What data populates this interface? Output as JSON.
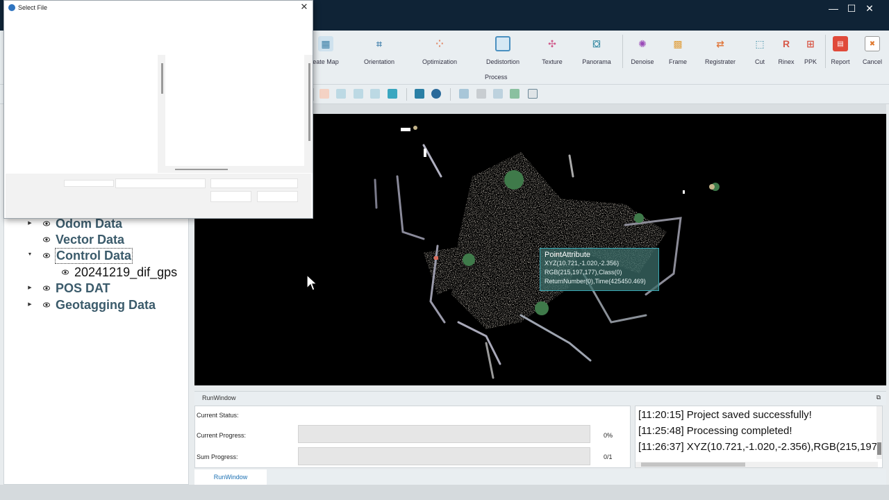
{
  "window": {
    "minimize": "—",
    "maximize": "☐",
    "close": "✕"
  },
  "ribbon": {
    "buttons": [
      {
        "label": "eate Map",
        "icon": "create-map-icon"
      },
      {
        "label": "Orientation",
        "icon": "orientation-icon"
      },
      {
        "label": "Optimization",
        "icon": "optimization-icon"
      },
      {
        "label": "Dedistortion",
        "icon": "dedistortion-icon"
      },
      {
        "label": "Texture",
        "icon": "texture-icon"
      },
      {
        "label": "Panorama",
        "icon": "panorama-icon"
      },
      {
        "label": "Denoise",
        "icon": "denoise-icon"
      },
      {
        "label": "Frame",
        "icon": "frame-icon"
      },
      {
        "label": "Registrater",
        "icon": "register-icon"
      },
      {
        "label": "Cut",
        "icon": "cut-icon"
      },
      {
        "label": "Rinex",
        "icon": "rinex-icon"
      },
      {
        "label": "PPK",
        "icon": "ppk-icon"
      },
      {
        "label": "Report",
        "icon": "report-icon"
      },
      {
        "label": "Cancel",
        "icon": "cancel-icon"
      }
    ],
    "group_label": "Process"
  },
  "tree": {
    "items": [
      {
        "label": "Odom Data"
      },
      {
        "label": "Vector Data"
      },
      {
        "label": "Control Data"
      },
      {
        "label": "20241219_dif_gps"
      },
      {
        "label": "POS DAT"
      },
      {
        "label": "Geotagging Data"
      }
    ]
  },
  "tooltip": {
    "title": "PointAttribute",
    "xyz": "XYZ(10.721,-1.020,-2.356)",
    "rgb": "RGB(215,197,177),Class(0)",
    "ret": "ReturnNumber(0),Time(425450.469)"
  },
  "run": {
    "title": "RunWindow",
    "float_icon": "⧉",
    "status_label": "Current Status:",
    "status_value": "",
    "progress_label": "Current Progress:",
    "progress_value": "0%",
    "progress_fraction": 0,
    "sum_label": "Sum Progress:",
    "sum_value": "0/1",
    "sum_fraction": 0,
    "tab": "RunWindow"
  },
  "log": [
    "[11:20:15] Project saved successfully!",
    "[11:25:48] Processing completed!",
    "[11:26:37] XYZ(10.721,-1.020,-2.356),RGB(215,197,"
  ],
  "dialog": {
    "title": "Select File",
    "close": "✕"
  },
  "colors": {
    "titlebar": "#0f2336",
    "selection": "#5cc0d0",
    "tree_text": "#3b5b6b",
    "accent": "#38a0b8"
  }
}
